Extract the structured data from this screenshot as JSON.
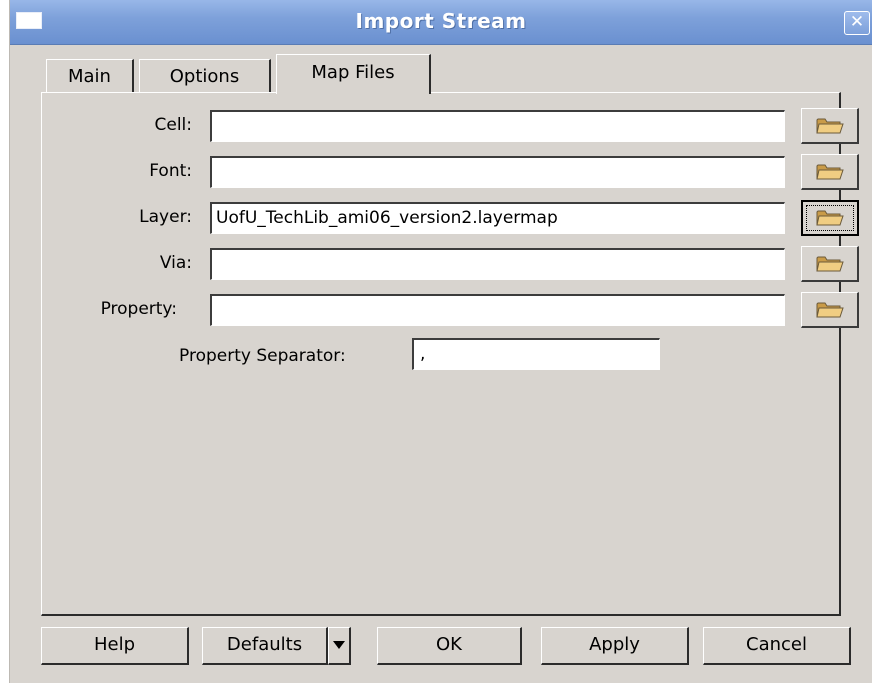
{
  "window": {
    "title": "Import Stream"
  },
  "tabs": [
    {
      "label": "Main"
    },
    {
      "label": "Options"
    },
    {
      "label": "Map Files"
    }
  ],
  "fields": [
    {
      "label": "Cell:",
      "value": ""
    },
    {
      "label": "Font:",
      "value": ""
    },
    {
      "label": "Layer:",
      "value": "UofU_TechLib_ami06_version2.layermap"
    },
    {
      "label": "Via:",
      "value": ""
    },
    {
      "label": "Property:",
      "value": ""
    }
  ],
  "property_separator": {
    "label": "Property Separator:",
    "value": ","
  },
  "buttons": {
    "help": "Help",
    "defaults": "Defaults",
    "ok": "OK",
    "apply": "Apply",
    "cancel": "Cancel"
  },
  "colors": {
    "titlebar": "#7ea1da",
    "window_bg": "#d8d4cf",
    "folder_icon": "#e3b96b"
  },
  "icons": {
    "menu": "window-menu-icon",
    "close": "close-icon",
    "browse": "folder-icon",
    "dropdown": "chevron-down-icon"
  }
}
